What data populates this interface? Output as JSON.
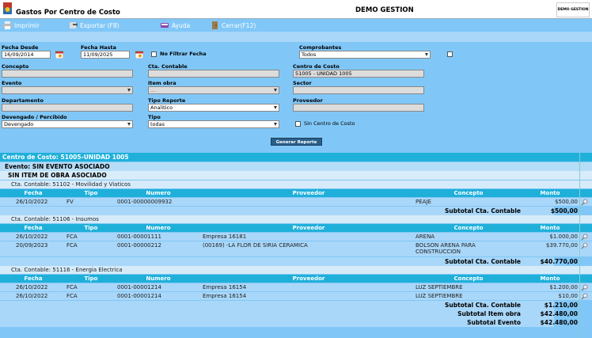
{
  "header": {
    "title": "Gastos Por Centro de Costo",
    "company": "DEMO GESTION",
    "company_badge": "DEMO GESTION"
  },
  "toolbar": {
    "print": "Imprimir",
    "export": "Exportar (F8)",
    "help": "Ayuda",
    "close": "Cerrar(F12)"
  },
  "filters": {
    "fecha_desde_label": "Fecha Desde",
    "fecha_desde": "16/09/2014",
    "fecha_hasta_label": "Fecha Hasta",
    "fecha_hasta": "11/09/2025",
    "no_filtrar_label": "No Filtrar Fecha",
    "comprobantes_label": "Comprobantes",
    "comprobantes": "Todos",
    "concepto_label": "Concepto",
    "concepto": "",
    "cta_contable_label": "Cta. Contable",
    "cta_contable": "",
    "centro_costo_label": "Centro de Costo",
    "centro_costo": "51005 - UNIDAD 1005",
    "evento_label": "Evento",
    "evento": "",
    "item_obra_label": "Item obra",
    "item_obra": "...",
    "sector_label": "Sector",
    "sector": "",
    "departamento_label": "Departamento",
    "departamento": "",
    "tipo_reporte_label": "Tipo Reporte",
    "tipo_reporte": "Analitico",
    "proveedor_label": "Proveedor",
    "proveedor": "",
    "devengado_label": "Devengado / Percibido",
    "devengado": "Devengado",
    "tipo_label": "Tipo",
    "tipo": "todas",
    "sin_centro_label": "Sin Centro de Costo",
    "generate_label": "Generar Reporte"
  },
  "report": {
    "centro": "Centro de Costo: 51005-UNIDAD 1005",
    "evento": "Evento: SIN EVENTO ASOCIADO",
    "item": "SIN ITEM DE OBRA ASOCIADO",
    "columns": [
      "Fecha",
      "Tipo",
      "Numero",
      "Proveedor",
      "Concepto",
      "Monto"
    ],
    "groups": [
      {
        "cta": "Cta. Contable: 51102 - Movilidad y Viaticos",
        "rows": [
          {
            "fecha": "26/10/2022",
            "tipo": "FV",
            "numero": "0001-00000009932",
            "proveedor": "",
            "concepto": "PEAJE",
            "concepto2": "",
            "monto": "$500,00"
          }
        ],
        "subtotal_label": "Subtotal Cta. Contable",
        "subtotal": "$500,00"
      },
      {
        "cta": "Cta. Contable: 51106 - Insumos",
        "rows": [
          {
            "fecha": "26/10/2022",
            "tipo": "FCA",
            "numero": "0001-00001111",
            "proveedor": "Empresa 16181",
            "concepto": "ARENA",
            "concepto2": "",
            "monto": "$1.000,00"
          },
          {
            "fecha": "20/09/2023",
            "tipo": "FCA",
            "numero": "0001-00000212",
            "proveedor": "(00169) -LA FLOR DE SIRIA CERAMICA",
            "concepto": "BOLSON ARENA PARA",
            "concepto2": "CONSTRUCCION",
            "monto": "$39.770,00"
          }
        ],
        "subtotal_label": "Subtotal Cta. Contable",
        "subtotal": "$40.770,00"
      },
      {
        "cta": "Cta. Contable: 51116 - Energia Electrica",
        "rows": [
          {
            "fecha": "26/10/2022",
            "tipo": "FCA",
            "numero": "0001-00001214",
            "proveedor": "Empresa 16154",
            "concepto": "LUZ SEPTIEMBRE",
            "concepto2": "",
            "monto": "$1.200,00"
          },
          {
            "fecha": "26/10/2022",
            "tipo": "FCA",
            "numero": "0001-00001214",
            "proveedor": "Empresa 16154",
            "concepto": "LUZ SEPTIEMBRE",
            "concepto2": "",
            "monto": "$10,00"
          }
        ],
        "subtotal_label": "Subtotal Cta. Contable",
        "subtotal": "$1.210,00"
      }
    ],
    "subtotal_item_label": "Subtotal Item obra",
    "subtotal_item": "$42.480,00",
    "subtotal_evento_label": "Subtotal Evento",
    "subtotal_evento": "$42.480,00"
  }
}
